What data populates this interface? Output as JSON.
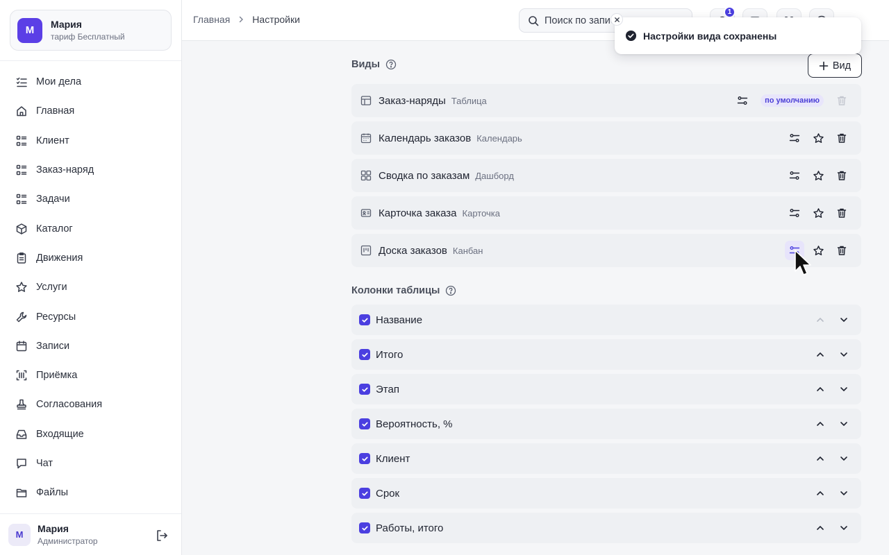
{
  "account": {
    "initial": "М",
    "name": "Мария",
    "plan": "тариф Бесплатный"
  },
  "nav": [
    {
      "label": "Мои дела",
      "icon": "todo-list-icon"
    },
    {
      "label": "Главная",
      "icon": "home-icon"
    },
    {
      "label": "Клиент",
      "icon": "list-icon"
    },
    {
      "label": "Заказ-наряд",
      "icon": "list-icon"
    },
    {
      "label": "Задачи",
      "icon": "list-icon"
    },
    {
      "label": "Каталог",
      "icon": "box-icon"
    },
    {
      "label": "Движения",
      "icon": "clipboard-icon"
    },
    {
      "label": "Услуги",
      "icon": "star-icon"
    },
    {
      "label": "Ресурсы",
      "icon": "wrench-icon"
    },
    {
      "label": "Записи",
      "icon": "calendar-icon"
    },
    {
      "label": "Приёмка",
      "icon": "scan-icon"
    },
    {
      "label": "Согласования",
      "icon": "stamp-icon"
    },
    {
      "label": "Входящие",
      "icon": "inbox-icon"
    },
    {
      "label": "Чат",
      "icon": "chat-icon"
    },
    {
      "label": "Файлы",
      "icon": "folder-icon"
    }
  ],
  "user": {
    "initial": "М",
    "name": "Мария",
    "role": "Администратор"
  },
  "breadcrumb": {
    "home": "Главная",
    "current": "Настройки"
  },
  "search": {
    "placeholder": "Поиск по записям"
  },
  "notifications": {
    "count": "1"
  },
  "toast": {
    "text": "Настройки вида сохранены"
  },
  "views_section": {
    "title": "Виды",
    "add_label": "Вид",
    "default_label": "по умолчанию",
    "items": [
      {
        "name": "Заказ-наряды",
        "type": "Таблица",
        "icon": "table-icon",
        "is_default": true
      },
      {
        "name": "Календарь заказов",
        "type": "Календарь",
        "icon": "calendar-icon",
        "is_default": false
      },
      {
        "name": "Сводка по заказам",
        "type": "Дашборд",
        "icon": "dashboard-icon",
        "is_default": false
      },
      {
        "name": "Карточка заказа",
        "type": "Карточка",
        "icon": "card-icon",
        "is_default": false
      },
      {
        "name": "Доска заказов",
        "type": "Канбан",
        "icon": "kanban-icon",
        "is_default": false
      }
    ]
  },
  "columns_section": {
    "title": "Колонки таблицы",
    "items": [
      {
        "name": "Название",
        "checked": true
      },
      {
        "name": "Итого",
        "checked": true
      },
      {
        "name": "Этап",
        "checked": true
      },
      {
        "name": "Вероятность, %",
        "checked": true
      },
      {
        "name": "Клиент",
        "checked": true
      },
      {
        "name": "Срок",
        "checked": true
      },
      {
        "name": "Работы, итого",
        "checked": true
      }
    ]
  },
  "colors": {
    "accent": "#4b3fe0",
    "brand": "#5b3fe6"
  }
}
